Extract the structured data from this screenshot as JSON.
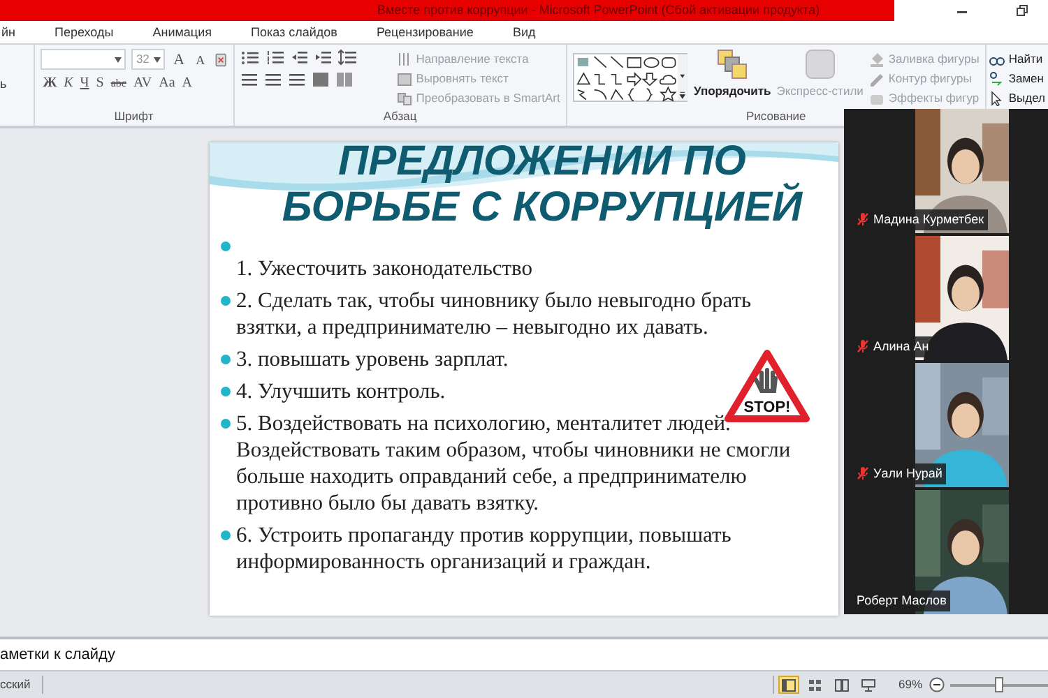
{
  "window": {
    "title": "Вместе против коррупции  -  Microsoft PowerPoint (Сбой активации продукта)"
  },
  "tabs": [
    {
      "label": "йн",
      "selected": false
    },
    {
      "label": "Переходы",
      "selected": false
    },
    {
      "label": "Анимация",
      "selected": false
    },
    {
      "label": "Показ слайдов",
      "selected": false
    },
    {
      "label": "Рецензирование",
      "selected": false
    },
    {
      "label": "Вид",
      "selected": false
    }
  ],
  "ribbon": {
    "left_fragment": "ь",
    "font": {
      "size": "32",
      "size_buttons": [
        "A",
        "A"
      ],
      "buttons": [
        "Ж",
        "К",
        "Ч",
        "S",
        "abc",
        "AV",
        "Aa",
        "A"
      ],
      "label": "Шрифт"
    },
    "paragraph": {
      "commands": [
        {
          "label": "Направление текста",
          "disabled": true
        },
        {
          "label": "Выровнять текст",
          "disabled": true
        },
        {
          "label": "Преобразовать в SmartArt",
          "disabled": true
        }
      ],
      "label": "Абзац"
    },
    "drawing": {
      "arrange": {
        "label": "Упорядочить",
        "disabled": false
      },
      "quick_styles": {
        "label": "Экспресс-стили",
        "disabled": true
      },
      "commands": [
        {
          "label": "Заливка фигуры",
          "disabled": true
        },
        {
          "label": "Контур фигуры",
          "disabled": true
        },
        {
          "label": "Эффекты фигур",
          "disabled": true
        }
      ],
      "label": "Рисование"
    },
    "editing": {
      "commands": [
        {
          "label": "Найти",
          "disabled": false
        },
        {
          "label": "Замен",
          "disabled": false
        },
        {
          "label": "Выдел",
          "disabled": false
        }
      ]
    }
  },
  "slide": {
    "title": [
      "ПРЕДЛОЖЕНИИ ПО",
      "БОРЬБЕ С КОРРУПЦИЕЙ"
    ],
    "items": [
      {
        "kind": "empty_bullet"
      },
      {
        "kind": "text",
        "bullet": false,
        "text": "1. Ужесточить законодательство"
      },
      {
        "kind": "text",
        "bullet": true,
        "text": "2. Сделать так, чтобы чиновнику было невыгодно брать взятки, а предпринимателю – невыгодно их давать."
      },
      {
        "kind": "text",
        "bullet": true,
        "text": "3. повышать уровень зарплат."
      },
      {
        "kind": "text",
        "bullet": true,
        "text": "4. Улучшить контроль."
      },
      {
        "kind": "text",
        "bullet": true,
        "text": "5. Воздействовать на психологию, менталитет людей. Воздействовать таким образом, чтобы чиновники не смогли больше находить оправданий себе, а предпринимателю противно было бы давать взятку."
      },
      {
        "kind": "text",
        "bullet": true,
        "text": "6. Устроить пропаганду против коррупции, повышать информированность организаций и граждан."
      }
    ],
    "sign_text": "STOP!"
  },
  "participants": [
    {
      "name": "Мадина Курметбек",
      "muted": true
    },
    {
      "name": "Алина Ан",
      "muted": true
    },
    {
      "name": "Уали Нурай",
      "muted": true
    },
    {
      "name": "Роберт Маслов",
      "muted": false
    }
  ],
  "notes": {
    "placeholder": "аметки к слайду"
  },
  "status_bar": {
    "language": "сский",
    "views": [
      {
        "selected": true
      },
      {
        "selected": false
      },
      {
        "selected": false
      },
      {
        "selected": false
      }
    ],
    "zoom": "69%",
    "zoom_slider": {
      "level": 0.5
    }
  }
}
